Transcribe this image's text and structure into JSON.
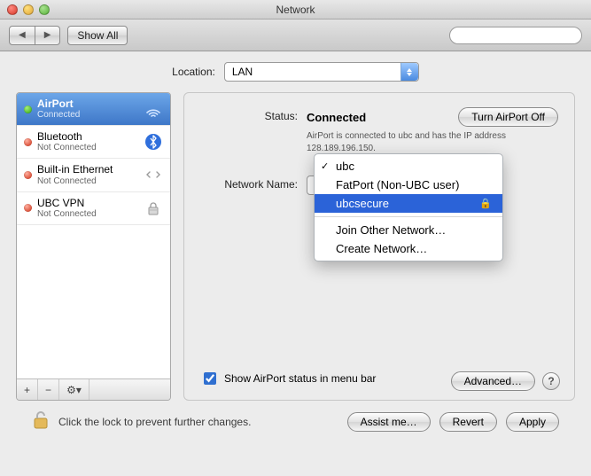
{
  "window_title": "Network",
  "toolbar": {
    "show_all": "Show All",
    "search_placeholder": ""
  },
  "location": {
    "label": "Location:",
    "value": "LAN"
  },
  "services": [
    {
      "name": "AirPort",
      "state": "Connected",
      "status_color": "green",
      "icon": "airport"
    },
    {
      "name": "Bluetooth",
      "state": "Not Connected",
      "status_color": "red",
      "icon": "bluetooth"
    },
    {
      "name": "Built-in Ethernet",
      "state": "Not Connected",
      "status_color": "red",
      "icon": "ethernet"
    },
    {
      "name": "UBC VPN",
      "state": "Not Connected",
      "status_color": "red",
      "icon": "vpn"
    }
  ],
  "sidebar_footer": {
    "add": "+",
    "remove": "−",
    "gear": "⚙▾"
  },
  "status": {
    "label": "Status:",
    "value": "Connected",
    "turn_off": "Turn AirPort Off",
    "subinfo": "AirPort is connected to ubc and has the IP address 128.189.196.150."
  },
  "network_name": {
    "label": "Network Name:",
    "menu": {
      "items": [
        "ubc",
        "FatPort (Non-UBC user)",
        "ubcsecure"
      ],
      "checked_index": 0,
      "selected_index": 2,
      "locked_index": 2,
      "actions": [
        "Join Other Network…",
        "Create Network…"
      ]
    }
  },
  "show_in_menu": {
    "checked": true,
    "label": "Show AirPort status in menu bar"
  },
  "advanced_label": "Advanced…",
  "help_label": "?",
  "lock_text": "Click the lock to prevent further changes.",
  "buttons": {
    "assist": "Assist me…",
    "revert": "Revert",
    "apply": "Apply"
  }
}
